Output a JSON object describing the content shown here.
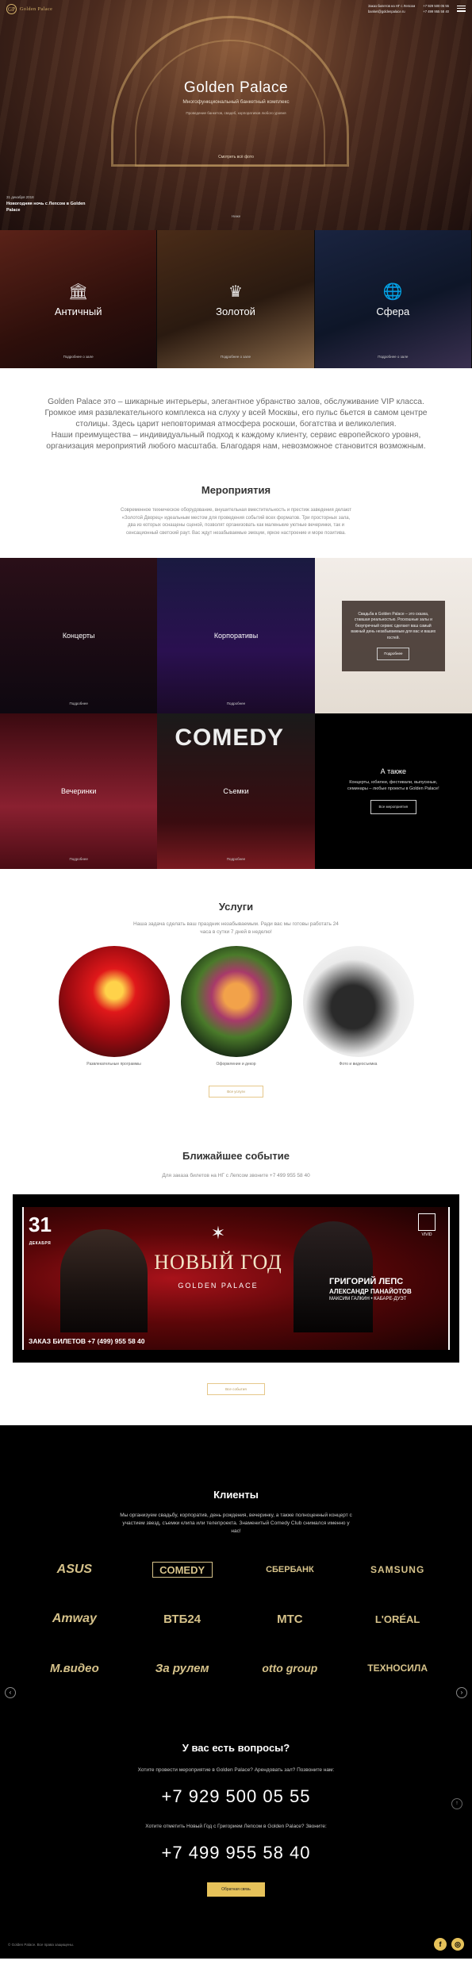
{
  "header": {
    "logo_mark": "GP",
    "logo_text": "Golden Palace",
    "address": "Заказ билетов на НГ с Лепсом",
    "email": "banket@goldenpalace.ru",
    "phone1": "+7 929 500 05 55",
    "phone2": "+7 499 955 58 40"
  },
  "hero": {
    "title": "Golden Palace",
    "subtitle": "Многофункциональный банкетный комплекс",
    "subtitle2": "Проведение банкетов, свадеб, корпоративов любого уровня",
    "button": "Смотреть всё фото",
    "news_date": "31 декабря 2018",
    "news_title": "Новогодняя ночь с Лепсом в Golden Palace",
    "more": "Ниже"
  },
  "halls": [
    {
      "icon": "column-icon",
      "glyph": "🏛",
      "name": "Античный",
      "more": "Подробнее о зале"
    },
    {
      "icon": "crown-icon",
      "glyph": "♛",
      "name": "Золотой",
      "more": "Подробнее о зале"
    },
    {
      "icon": "globe-icon",
      "glyph": "🌐",
      "name": "Сфера",
      "more": "Подробнее о зале"
    }
  ],
  "about": {
    "p1": "Golden Palace это – шикарные интерьеры, элегантное убранство залов, обслуживание VIP класса. Громкое имя развлекательного комплекса на слуху у всей Москвы, его пульс бьется в самом центре столицы. Здесь царит неповторимая атмосфера роскоши, богатства и великолепия.",
    "p2": "Наши преимущества – индивидуальный подход к каждому клиенту, сервис европейского уровня, организация мероприятий любого масштаба. Благодаря нам, невозможное становится возможным."
  },
  "events": {
    "title": "Мероприятия",
    "text": "Современное техническое оборудование, внушительная вместительность и престиж заведения делают «Золотой Дворец» идеальным местом для проведения событий всех форматов. Три просторных зала, два из которых оснащены сценой, позволят организовать как маленькие уютные вечеринки, так и сенсационный светский раут. Вас ждут незабываемые эмоции, яркое настроение и море позитива.",
    "items": [
      {
        "name": "Концерты",
        "more": "Подробнее"
      },
      {
        "name": "Корпоративы",
        "more": "Подробнее"
      },
      {
        "name": "Вечеринки",
        "more": "Подробнее"
      },
      {
        "name": "Съемки",
        "more": "Подробнее"
      }
    ],
    "wedding_text": "Свадьба в Golden Palace – это сказка, ставшая реальностью. Роскошные залы и безупречный сервис сделают ваш самый важный день незабываемым для вас и ваших гостей.",
    "wedding_btn": "Подробнее",
    "comedy_sign": "COMEDY",
    "also_title": "А также",
    "also_text": "Концерты, юбилеи, фестивали, выпускные, семинары – любые проекты в Golden Palace!",
    "also_btn": "Все мероприятия"
  },
  "services": {
    "title": "Услуги",
    "text": "Наша задача сделать ваш праздник незабываемым. Ради вас мы готовы работать 24 часа в сутки 7 дней в неделю!",
    "items": [
      {
        "label": "Развлекательные программы"
      },
      {
        "label": "Оформление и декор"
      },
      {
        "label": "Фото и видеосъемка"
      }
    ],
    "button": "Все услуги"
  },
  "nearest": {
    "title": "Ближайшее событие",
    "text": "Для заказа билетов на НГ с Лепсом звоните +7 499 955 58 40",
    "date_num": "31",
    "date_month": "ДЕКАБРЯ",
    "event_title": "НОВЫЙ ГОД",
    "venue": "GOLDEN PALACE",
    "tree": "✶",
    "phone_line": "ЗАКАЗ БИЛЕТОВ +7 (499) 955 58 40",
    "artist1": "ГРИГОРИЙ ЛЕПС",
    "artist2": "АЛЕКСАНДР ПАНАЙОТОВ",
    "artist3": "МАКСИМ ГАЛКИН • КАБАРЕ-ДУЭТ",
    "vivid": "VIVID",
    "button": "Все события"
  },
  "clients": {
    "title": "Клиенты",
    "text": "Мы организуем свадьбу, корпоратив, день рождения, вечеринку, а также полноценный концерт с участием звезд, съемки клипа или телепроекта. Знаменитый Comedy Club снимался именно у нас!",
    "logos": [
      "ASUS",
      "COMEDY",
      "СБЕРБАНК",
      "SAMSUNG",
      "Amway",
      "ВТБ24",
      "МТС",
      "L'ORÉAL",
      "М.видео",
      "За рулем",
      "otto group",
      "ТЕХНОСИЛА"
    ],
    "prev": "‹",
    "next": "›"
  },
  "faq": {
    "title": "У вас есть вопросы?",
    "q1": "Хотите провести мероприятие в Golden Palace? Арендовать зал? Позвоните нам:",
    "phone1": "+7 929 500 05 55",
    "q2": "Хотите отметить Новый Год с Григорием Лепсом в Golden Palace? Звоните:",
    "phone2": "+7 499 955 58 40",
    "button": "Обратная связь",
    "up": "↑"
  },
  "footer": {
    "copyright": "© Golden Palace. Все права защищены.",
    "facebook": "f",
    "instagram": "◎"
  },
  "colors": {
    "gold": "#e6c25a",
    "black": "#000000"
  }
}
